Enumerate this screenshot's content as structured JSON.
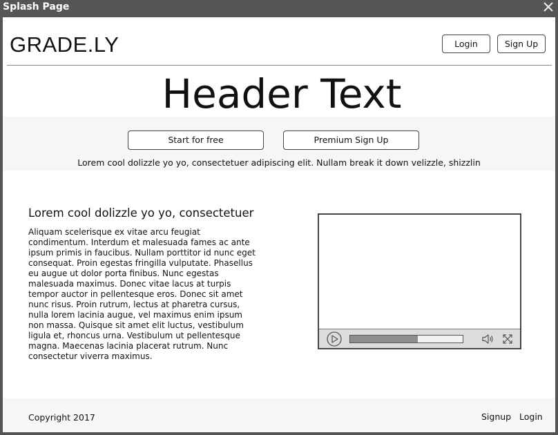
{
  "window": {
    "title": "Splash Page",
    "close_icon": "close-icon"
  },
  "nav": {
    "logo": "GRADE.LY",
    "login_label": "Login",
    "signup_label": "Sign Up"
  },
  "hero": {
    "header_text": "Header Text",
    "start_free_label": "Start for free",
    "premium_label": "Premium Sign Up",
    "tagline": "Lorem cool dolizzle yo yo, consectetuer adipiscing elit. Nullam break it down velizzle, shizzlin"
  },
  "content": {
    "section_title": "Lorem cool dolizzle yo yo, consectetuer",
    "body_text": "Aliquam scelerisque ex vitae arcu feugiat condimentum. Interdum et malesuada fames ac ante ipsum primis in faucibus. Nullam porttitor id nunc eget consequat. Proin egestas fringilla vulputate. Phasellus eu augue ut dolor porta finibus. Nunc egestas malesuada maximus. Donec vitae lacus at turpis tempor auctor in pellentesque eros. Donec sit amet nunc risus. Proin rutrum, lectus at pharetra cursus, nulla lorem lacinia augue, vel maximus enim ipsum non massa. Quisque sit amet elit luctus, vestibulum ligula et, rhoncus urna. Vestibulum ut pellentesque magna. Maecenas lacinia placerat rutrum. Nunc consectetur viverra maximus."
  },
  "video_player": {
    "progress_fraction": 0.6,
    "icons": [
      "play-icon",
      "volume-icon",
      "fullscreen-icon"
    ]
  },
  "footer": {
    "copyright": "Copyright 2017",
    "signup_label": "Signup",
    "login_label": "Login"
  }
}
